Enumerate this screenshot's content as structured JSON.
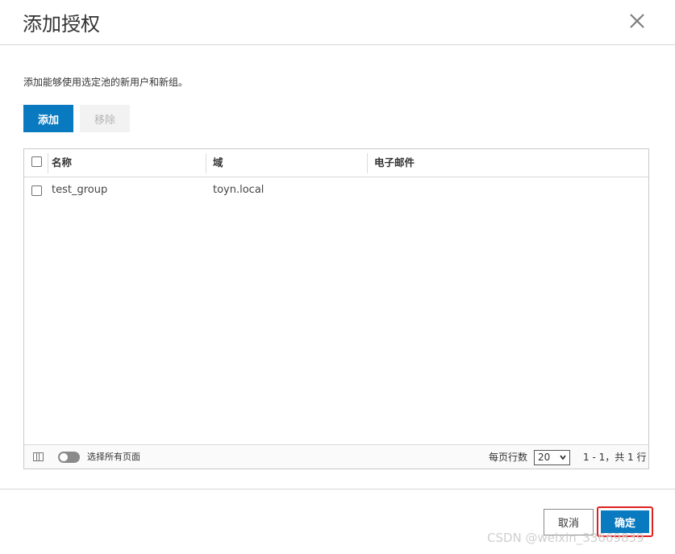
{
  "dialog": {
    "title": "添加授权",
    "description": "添加能够使用选定池的新用户和新组。"
  },
  "toolbar": {
    "add_label": "添加",
    "remove_label": "移除"
  },
  "table": {
    "columns": [
      "名称",
      "域",
      "电子邮件"
    ],
    "rows": [
      {
        "name": "test_group",
        "domain": "toyn.local",
        "email": ""
      }
    ]
  },
  "grid_footer": {
    "select_all_pages_label": "选择所有页面",
    "rows_per_page_label": "每页行数",
    "rows_per_page_value": "20",
    "range_text": "1 - 1，共 1 行"
  },
  "actions": {
    "cancel_label": "取消",
    "ok_label": "确定"
  },
  "watermark": "CSDN @weixin_33669839"
}
